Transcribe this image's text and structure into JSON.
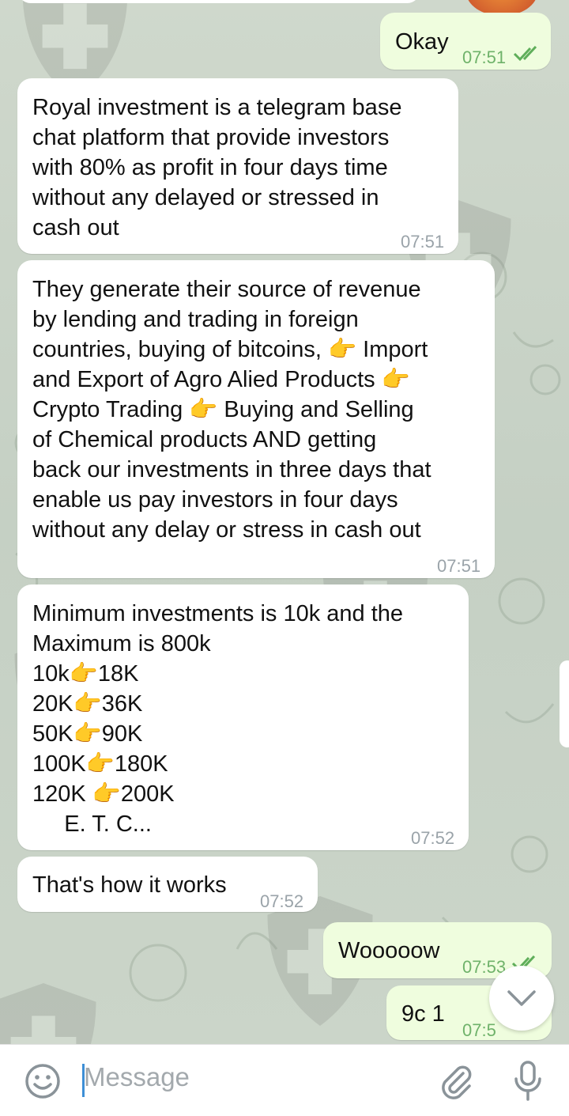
{
  "messages": [
    {
      "id": "m1",
      "dir": "out",
      "text": "Okay",
      "time": "07:51",
      "read": true
    },
    {
      "id": "m2",
      "dir": "in",
      "text": "Royal investment is a telegram base\nchat platform that provide investors\nwith 80% as profit in four days time\nwithout any delayed or stressed in\ncash out",
      "time": "07:51"
    },
    {
      "id": "m3",
      "dir": "in",
      "text": "They generate their source of revenue\nby lending and trading in foreign\ncountries, buying of bitcoins, 👉 Import\nand Export of Agro Alied Products 👉\nCrypto Trading 👉 Buying and Selling\nof Chemical products AND getting\nback our investments in three days that\nenable us pay investors in four days\nwithout any delay or stress in cash out",
      "time": "07:51"
    },
    {
      "id": "m4",
      "dir": "in",
      "text": "Minimum investments is 10k and the\nMaximum is 800k\n10k👉18K\n20K👉36K\n50K👉90K\n100K👉180K\n120K 👉200K\n     E. T. C...",
      "time": "07:52"
    },
    {
      "id": "m5",
      "dir": "in",
      "text": "That's how it works",
      "time": "07:52"
    },
    {
      "id": "m6",
      "dir": "out",
      "text": "Wooooow",
      "time": "07:53",
      "read": true
    },
    {
      "id": "m7",
      "dir": "out",
      "text": "9c 1",
      "time": "07:5",
      "read": true
    }
  ],
  "input": {
    "placeholder": "Message"
  },
  "icons": {
    "emoji": "emoji-icon",
    "attach": "paperclip-icon",
    "mic": "microphone-icon",
    "scroll": "chevron-down-icon"
  },
  "colors": {
    "outgoing": "#effdde",
    "incoming": "#ffffff",
    "accent": "#3d8fd6",
    "checks": "#5fae5a"
  }
}
